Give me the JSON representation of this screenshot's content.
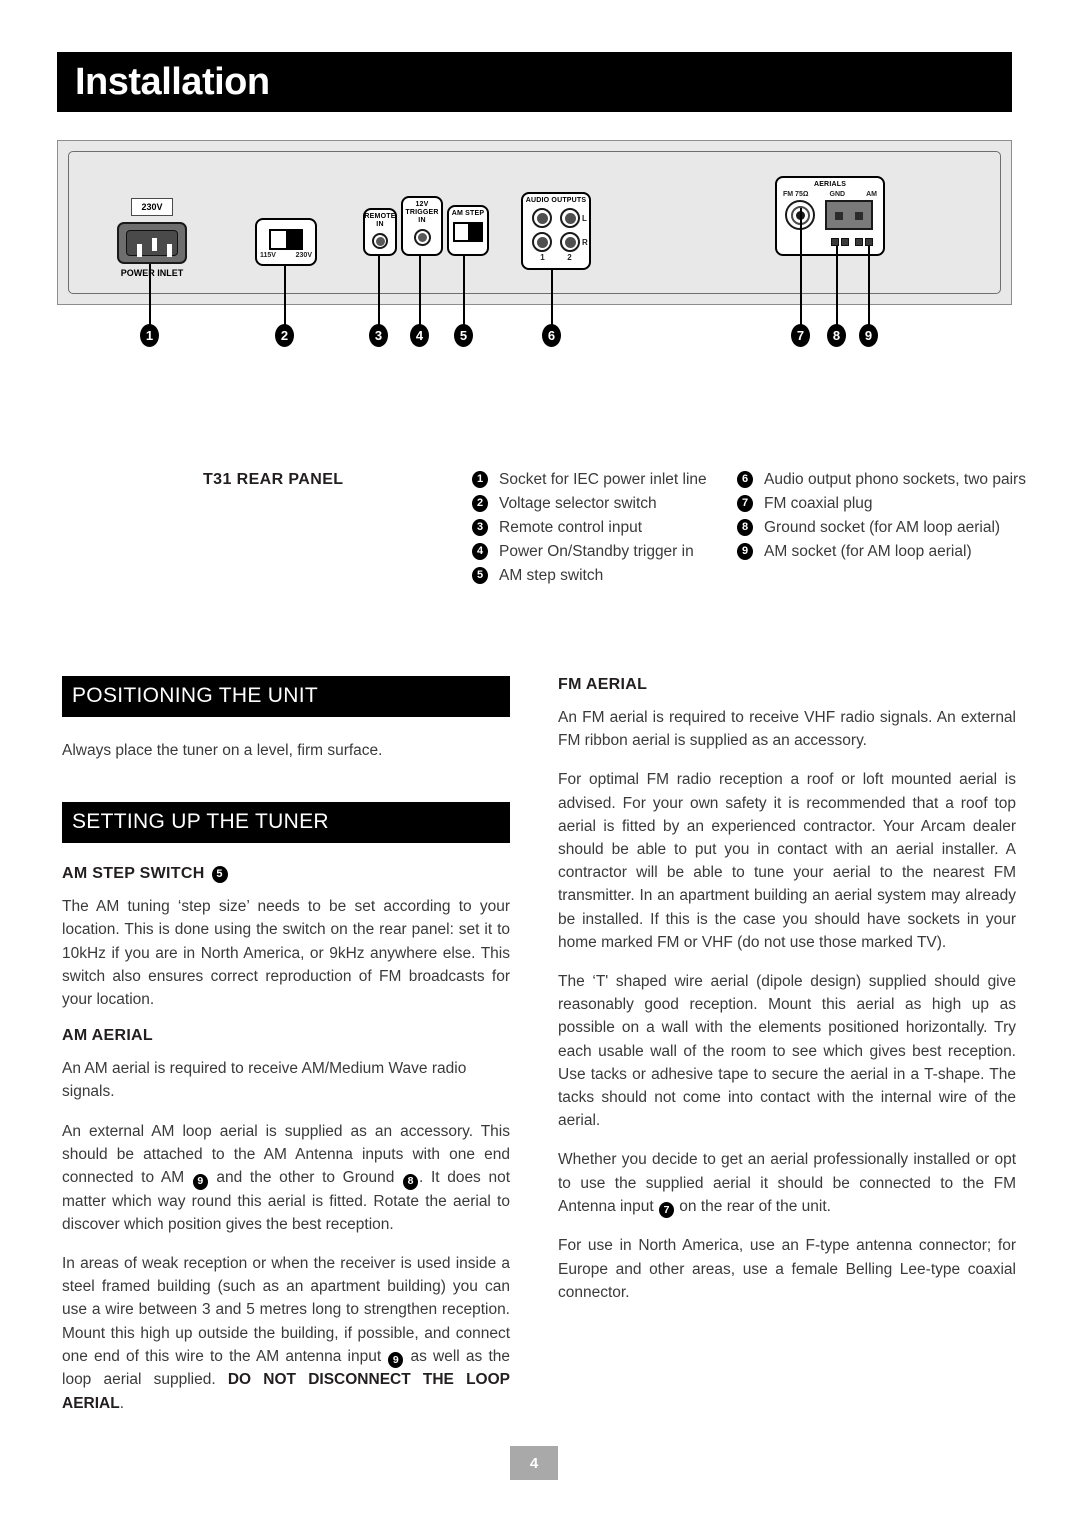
{
  "page": {
    "title": "Installation",
    "page_number": "4"
  },
  "panel": {
    "voltage_badge": "230V",
    "power_inlet_label": "POWER INLET",
    "voltage_selector": {
      "left": "115V",
      "right": "230V"
    },
    "remote_in": "REMOTE IN",
    "remote_in_line1": "REMOTE",
    "remote_in_line2": "IN",
    "trigger_line1": "12V",
    "trigger_line2": "TRIGGER",
    "trigger_line3": "IN",
    "am_step": "AM STEP",
    "audio_outputs": "AUDIO OUTPUTS",
    "audio_left": "L",
    "audio_right": "R",
    "audio_num1": "1",
    "audio_num2": "2",
    "aerials": "AERIALS",
    "fm75": "FM 75Ω",
    "gnd": "GND",
    "am": "AM",
    "callouts": [
      "1",
      "2",
      "3",
      "4",
      "5",
      "6",
      "7",
      "8",
      "9"
    ]
  },
  "legend": {
    "title": "T31 REAR PANEL",
    "column1": [
      {
        "num": "1",
        "text": "Socket for IEC power inlet line"
      },
      {
        "num": "2",
        "text": "Voltage selector switch"
      },
      {
        "num": "3",
        "text": "Remote control input"
      },
      {
        "num": "4",
        "text": "Power On/Standby trigger in"
      },
      {
        "num": "5",
        "text": "AM step switch"
      }
    ],
    "column2": [
      {
        "num": "6",
        "text": "Audio output phono sockets, two pairs"
      },
      {
        "num": "7",
        "text": "FM coaxial plug"
      },
      {
        "num": "8",
        "text": "Ground socket (for AM loop aerial)"
      },
      {
        "num": "9",
        "text": "AM socket (for AM loop aerial)"
      }
    ]
  },
  "left_column": {
    "positioning_heading": "POSITIONING THE UNIT",
    "positioning_body": "Always place the tuner on a level, firm surface.",
    "setting_up_heading": "SETTING UP THE TUNER",
    "am_step_heading": "AM STEP SWITCH",
    "am_step_heading_num": "5",
    "am_step_body": "The AM tuning ‘step size’ needs to be set according to your location. This is done using the switch on the rear panel: set it to 10kHz if you are in North America, or 9kHz anywhere else. This switch also ensures correct reproduction of FM broadcasts for your location.",
    "am_aerial_heading": "AM AERIAL",
    "am_aerial_p1": "An AM aerial is required to receive AM/Medium Wave radio signals.",
    "am_aerial_p2_a": "An external AM loop aerial is supplied as an accessory. This should be attached to the AM Antenna inputs with one end connected to AM",
    "am_aerial_p2_num1": "9",
    "am_aerial_p2_b": "and the other to Ground",
    "am_aerial_p2_num2": "8",
    "am_aerial_p2_c": ". It does not matter which way round this aerial is fitted. Rotate the aerial to discover which position gives the best reception.",
    "am_aerial_p3_a": "In areas of weak reception or when the receiver is used inside a steel framed building (such as an apartment building) you can use a wire between 3 and 5 metres long to strengthen reception. Mount this high up outside the building, if possible, and connect one end of this wire to the AM antenna input",
    "am_aerial_p3_num": "9",
    "am_aerial_p3_b": "as well as the loop aerial supplied.",
    "am_aerial_p3_bold": "DO NOT DISCONNECT THE LOOP AERIAL",
    "am_aerial_p3_end": "."
  },
  "right_column": {
    "fm_aerial_heading": "FM AERIAL",
    "fm_p1": "An FM aerial is required to receive VHF radio signals. An external FM ribbon aerial is supplied as an accessory.",
    "fm_p2": "For optimal FM radio reception a roof or loft mounted aerial is advised. For your own safety it is recommended that a roof top aerial is fitted by an experienced contractor. Your Arcam dealer should be able to put you in contact with an aerial installer. A contractor will be able to tune your aerial to the nearest FM transmitter. In an apartment building an aerial system may already be installed. If this is the case you should have sockets in your home marked FM or VHF (do not use those marked TV).",
    "fm_p3": "The ‘T' shaped wire aerial (dipole design) supplied should give reasonably good reception. Mount this aerial as high up as possible on a wall with the elements positioned horizontally. Try each usable wall of the room to see which gives best reception. Use tacks or adhesive tape to secure the aerial in a T-shape. The tacks should not come into contact with the internal wire of the aerial.",
    "fm_p4_a": "Whether you decide to get an aerial professionally installed or opt to use the supplied aerial it should be connected to the FM Antenna input",
    "fm_p4_num": "7",
    "fm_p4_b": "on the rear of the unit.",
    "fm_p5": "For use in North America, use an F-type antenna connector; for Europe and other areas, use a female Belling Lee-type coaxial connector."
  }
}
